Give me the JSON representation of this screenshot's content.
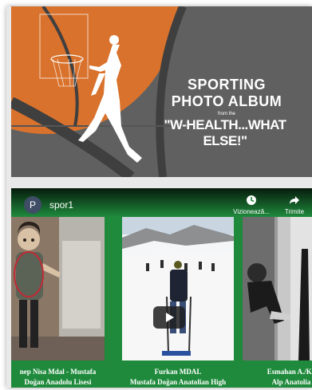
{
  "banner": {
    "line1": "SPORTING",
    "line2": "PHOTO ALBUM",
    "line3": "from the",
    "line4": "\"W-HEALTH...WHAT ELSE!\""
  },
  "player": {
    "avatar_letter": "P",
    "channel": "spor1",
    "watch_later_label": "Vizionează...",
    "share_label": "Trimite"
  },
  "cards": [
    {
      "caption_line1": "nep Nisa Mdal - Mustafa",
      "caption_line2": "Doğan Anadolu Lisesi"
    },
    {
      "caption_line1": "Furkan MDAL",
      "caption_line2": "Mustafa Doğan Anatolian High"
    },
    {
      "caption_line1": "Esmahan A./Ka",
      "caption_line2": "Alp Anatolia"
    }
  ],
  "colors": {
    "banner_bg": "#606060",
    "ball_orange": "#d9722c",
    "player_bg": "#1f8a3c"
  }
}
